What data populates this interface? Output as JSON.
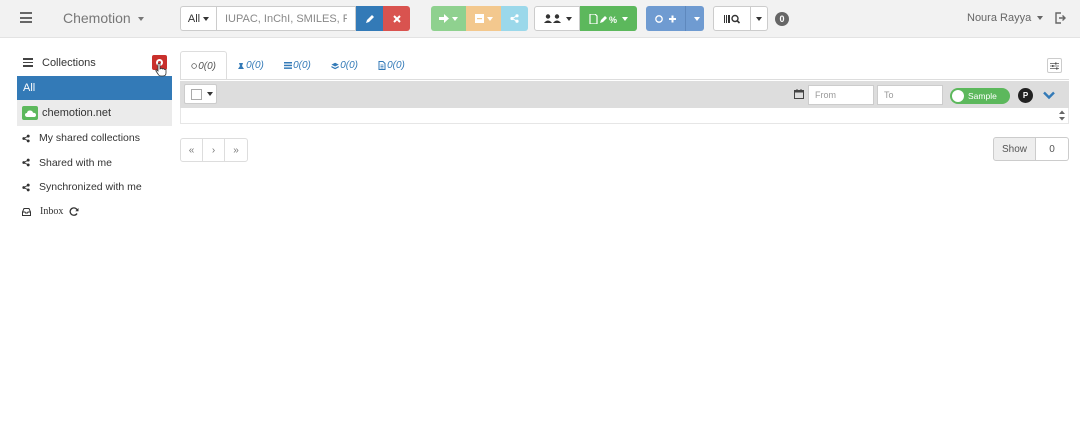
{
  "navbar": {
    "menu_icon": "hamburger-icon",
    "brand": "Chemotion",
    "search": {
      "scope": "All",
      "placeholder": "IUPAC, InChI, SMILES, RInChI"
    },
    "badge_count": "0",
    "user": "Noura Rayya"
  },
  "sidebar": {
    "header": "Collections",
    "all": "All",
    "chemotion": "chemotion.net",
    "items": [
      {
        "label": "My shared collections",
        "icon": "share-icon"
      },
      {
        "label": "Shared with me",
        "icon": "share-icon"
      },
      {
        "label": "Synchronized with me",
        "icon": "share-icon"
      },
      {
        "label": "Inbox",
        "icon": "inbox-icon"
      }
    ]
  },
  "tabs": [
    {
      "label": "0(0)",
      "icon": "sample-icon"
    },
    {
      "label": "0(0)",
      "icon": "reaction-icon"
    },
    {
      "label": "0(0)",
      "icon": "wellplate-icon"
    },
    {
      "label": "0(0)",
      "icon": "screen-icon"
    },
    {
      "label": "0(0)",
      "icon": "research-plan-icon"
    }
  ],
  "filter": {
    "from_placeholder": "From",
    "to_placeholder": "To",
    "toggle_label": "Sample",
    "p_label": "P"
  },
  "pagination": {
    "first": "«",
    "next": "›",
    "last": "»"
  },
  "show": {
    "label": "Show",
    "value": "0"
  },
  "colors": {
    "primary": "#337ab7",
    "danger": "#d9534f",
    "success": "#5cb85c",
    "navbar_bg": "#f2f2f2"
  }
}
